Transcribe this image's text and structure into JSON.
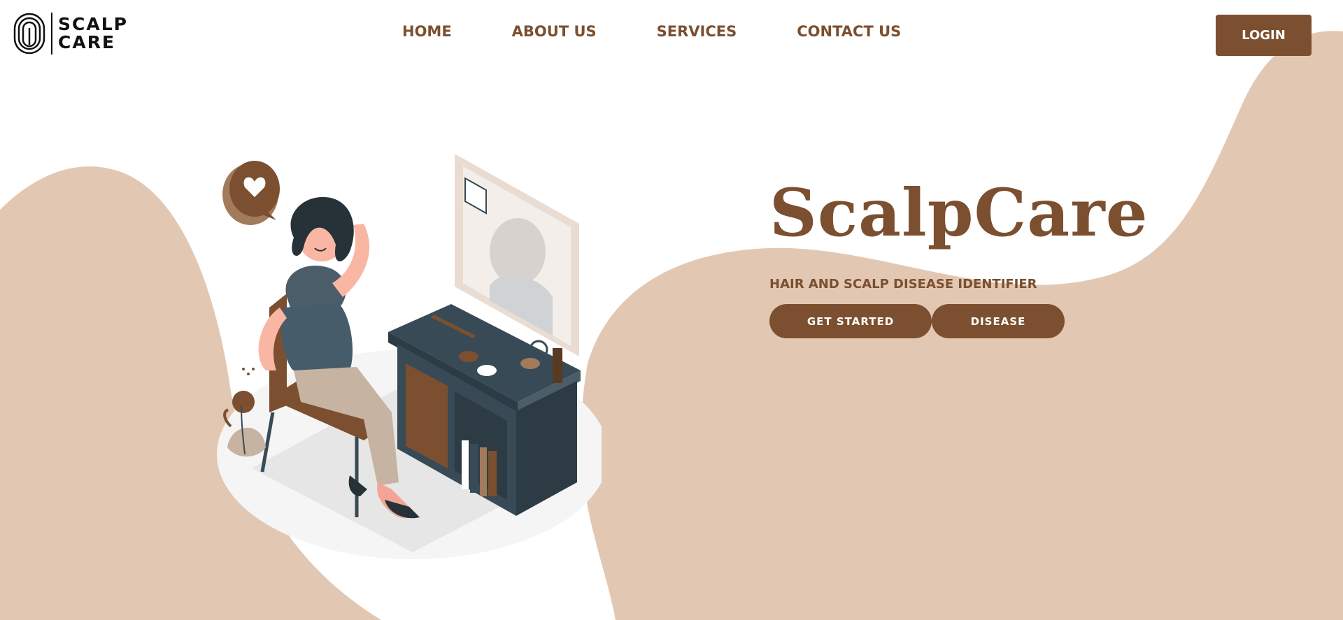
{
  "colors": {
    "brand_brown": "#7b4f2f",
    "wave_beige": "#e2c8b3",
    "background": "#ffffff"
  },
  "header": {
    "logo": {
      "icon": "fingerprint-icon",
      "line1": "SCALP",
      "line2": "CARE"
    },
    "nav": [
      {
        "label": "HOME"
      },
      {
        "label": "ABOUT US"
      },
      {
        "label": "SERVICES"
      },
      {
        "label": "CONTACT US"
      }
    ],
    "login_label": "LOGIN"
  },
  "hero": {
    "title": "ScalpCare",
    "subtitle": "HAIR AND SCALP DISEASE IDENTIFIER",
    "primary_button": "GET STARTED",
    "secondary_button": "DISEASE"
  },
  "illustration": {
    "name": "woman-at-vanity-illustration",
    "icons": [
      "heart-speech-bubble-icon",
      "mirror-icon",
      "plant-icon"
    ]
  }
}
